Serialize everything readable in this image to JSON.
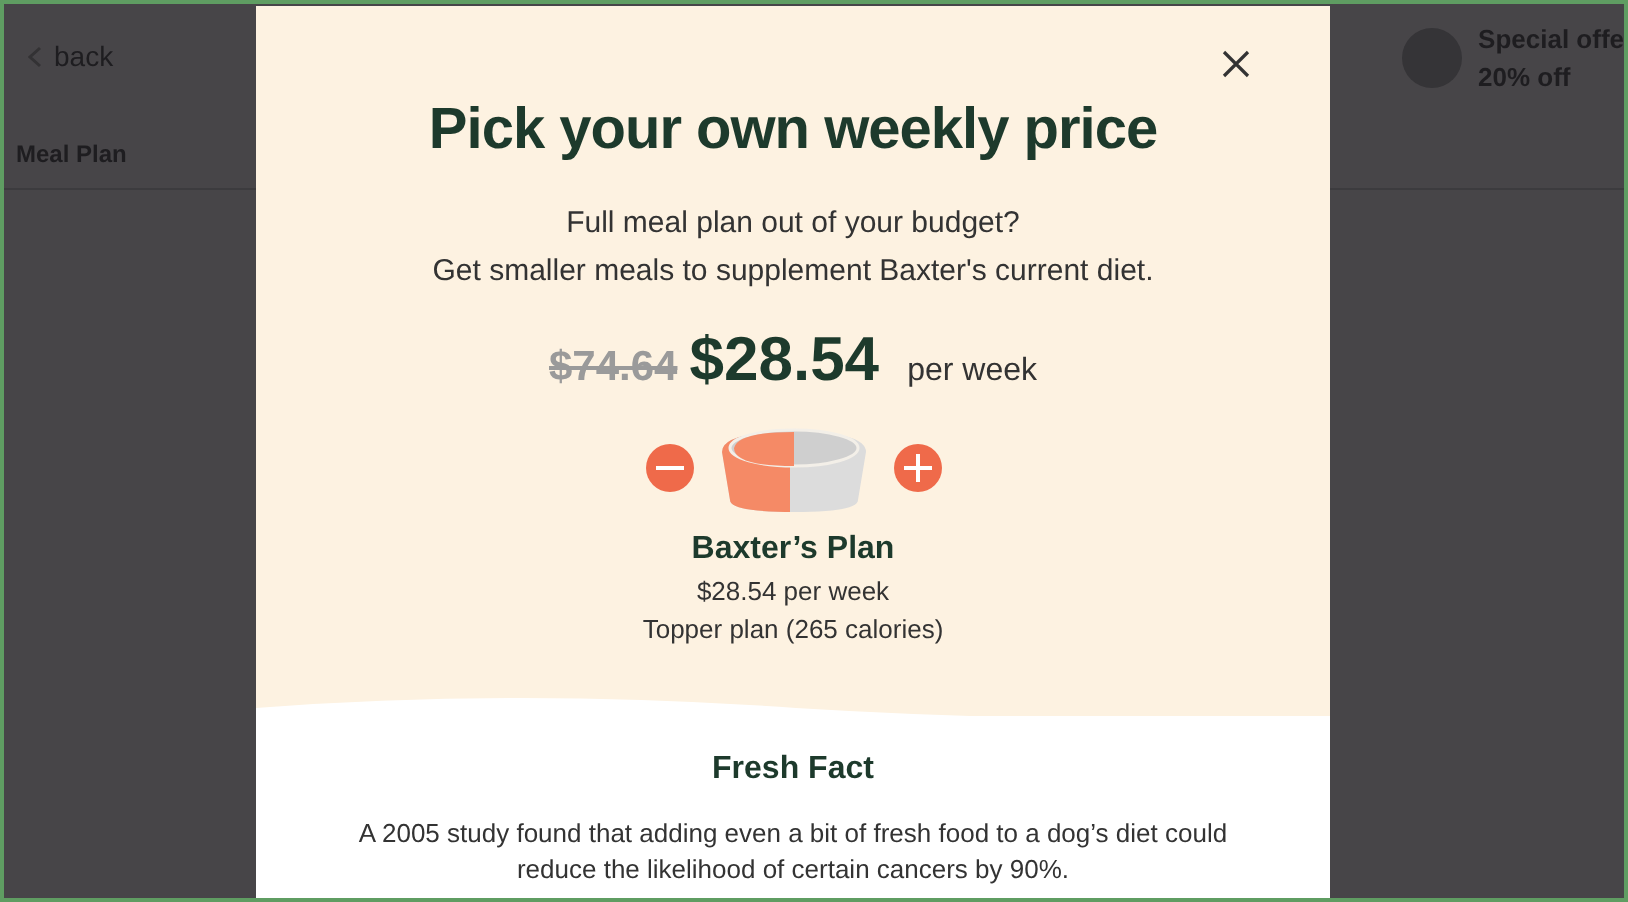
{
  "background_page": {
    "back_link": "back",
    "section_title": "Meal Plan",
    "offer": {
      "title": "Special offe",
      "discount": "20% off"
    }
  },
  "modal": {
    "title": "Pick your own weekly price",
    "subtitle_lines": [
      "Full meal plan out of your budget?",
      "Get smaller meals to supplement Baxter's current diet."
    ],
    "old_price": "$74.64",
    "new_price": "$28.54",
    "price_unit": "per week",
    "bowl": {
      "level": 0.5
    },
    "plan": {
      "name": "Baxter’s Plan",
      "price": "$28.54 per week",
      "description": "Topper plan (265 calories)"
    },
    "fact": {
      "title": "Fresh Fact",
      "text": "A 2005 study found that adding even a bit of fresh food to a dog’s diet could reduce the likelihood of certain cancers by 90%."
    }
  }
}
